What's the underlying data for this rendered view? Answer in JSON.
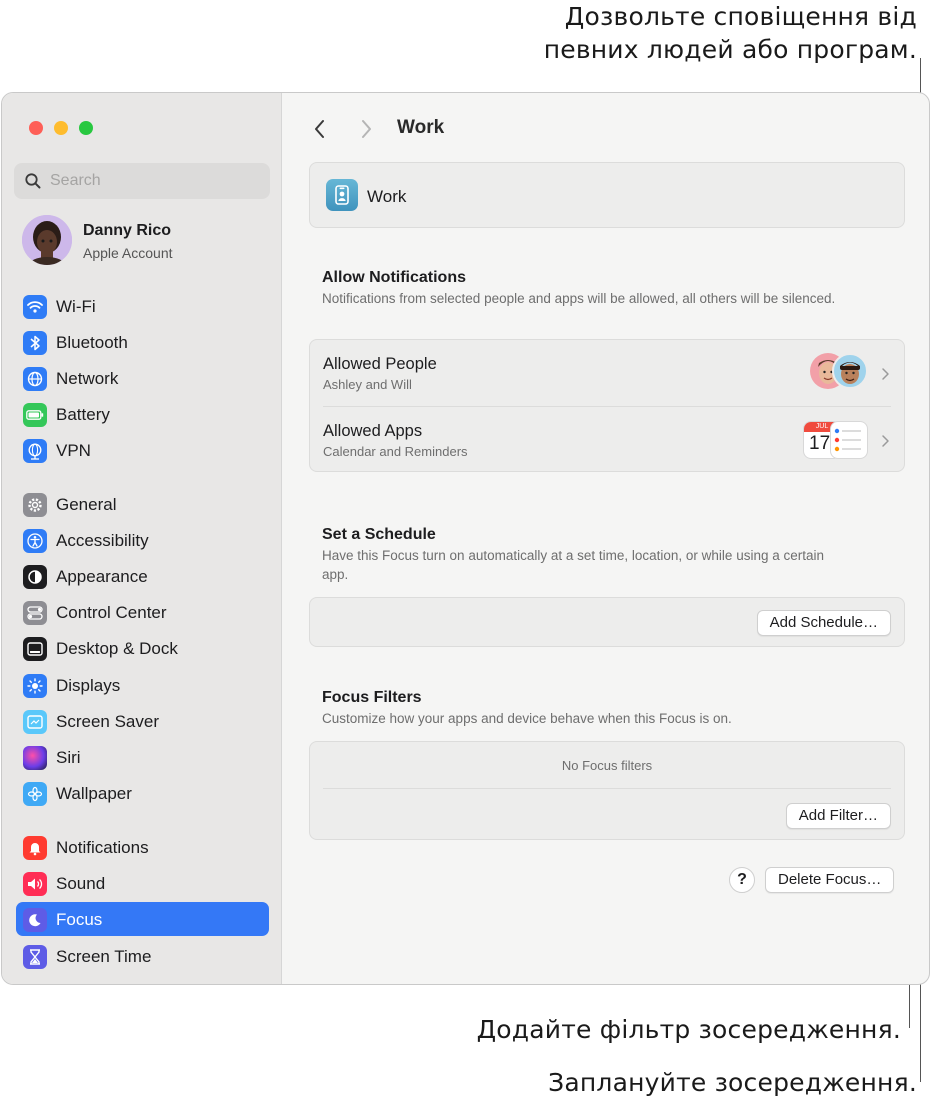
{
  "callouts": {
    "allow_line1": "Дозвольте сповіщення від",
    "allow_line2": "певних людей або програм.",
    "filter": "Додайте фільтр зосередження.",
    "schedule": "Заплануйте зосередження."
  },
  "search": {
    "placeholder": "Search"
  },
  "account": {
    "name": "Danny Rico",
    "subtitle": "Apple Account"
  },
  "sidebar": {
    "items": [
      {
        "label": "Wi-Fi",
        "icon": "wifi-icon",
        "color": "#2f7cf6"
      },
      {
        "label": "Bluetooth",
        "icon": "bluetooth-icon",
        "color": "#2f7cf6"
      },
      {
        "label": "Network",
        "icon": "globe-icon",
        "color": "#2f7cf6"
      },
      {
        "label": "Battery",
        "icon": "battery-icon",
        "color": "#34c759"
      },
      {
        "label": "VPN",
        "icon": "vpn-globe-icon",
        "color": "#2f7cf6"
      },
      {
        "label": "General",
        "icon": "gear-icon",
        "color": "#8e8e93"
      },
      {
        "label": "Accessibility",
        "icon": "accessibility-icon",
        "color": "#2f7cf6"
      },
      {
        "label": "Appearance",
        "icon": "appearance-icon",
        "color": "#1d1d1f"
      },
      {
        "label": "Control Center",
        "icon": "control-center-icon",
        "color": "#8e8e93"
      },
      {
        "label": "Desktop & Dock",
        "icon": "dock-icon",
        "color": "#1d1d1f"
      },
      {
        "label": "Displays",
        "icon": "sun-icon",
        "color": "#2f7cf6"
      },
      {
        "label": "Screen Saver",
        "icon": "screen-saver-icon",
        "color": "#5ac8fa"
      },
      {
        "label": "Siri",
        "icon": "siri-icon",
        "color": "#6a3de8"
      },
      {
        "label": "Wallpaper",
        "icon": "flower-icon",
        "color": "#3fa9f5"
      },
      {
        "label": "Notifications",
        "icon": "bell-icon",
        "color": "#ff3b30"
      },
      {
        "label": "Sound",
        "icon": "speaker-icon",
        "color": "#ff2d55"
      },
      {
        "label": "Focus",
        "icon": "moon-icon",
        "color": "#5e5ce6"
      },
      {
        "label": "Screen Time",
        "icon": "hourglass-icon",
        "color": "#5e5ce6"
      }
    ],
    "selected": "Focus"
  },
  "main": {
    "title": "Work",
    "focus_name": "Work",
    "allow": {
      "title": "Allow Notifications",
      "description": "Notifications from selected people and apps will be allowed, all others will be silenced.",
      "people_title": "Allowed People",
      "people_sub": "Ashley and Will",
      "apps_title": "Allowed Apps",
      "apps_sub": "Calendar and Reminders",
      "calendar_month": "JUL",
      "calendar_day": "17"
    },
    "schedule": {
      "title": "Set a Schedule",
      "description": "Have this Focus turn on automatically at a set time, location, or while using a certain app.",
      "button": "Add Schedule…"
    },
    "filters": {
      "title": "Focus Filters",
      "description": "Customize how your apps and device behave when this Focus is on.",
      "empty": "No Focus filters",
      "button": "Add Filter…"
    },
    "help": "?",
    "delete_button": "Delete Focus…"
  }
}
